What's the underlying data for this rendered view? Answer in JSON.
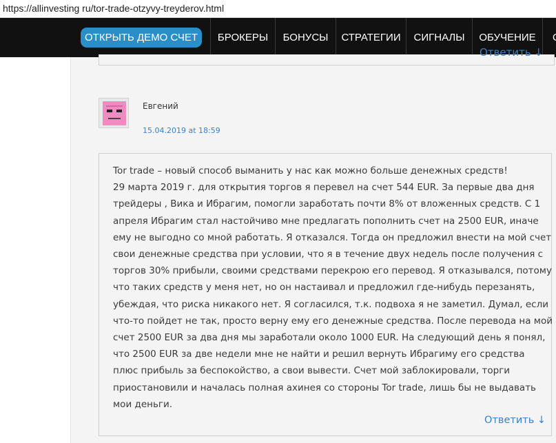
{
  "browser": {
    "url": "https://allinvesting ru/tor-trade-otzyvy-treyderov.html"
  },
  "nav": {
    "demo_label": "ОТКРЫТЬ ДЕМО СЧЕТ",
    "items": [
      "БРОКЕРЫ",
      "БОНУСЫ",
      "СТРАТЕГИИ",
      "СИГНАЛЫ",
      "ОБУЧЕНИЕ",
      "ОТЗ"
    ],
    "colors": {
      "background": "#111111",
      "demo_button": "#2a8fc7"
    }
  },
  "previous_comment": {
    "reply_label": "Ответить ↓"
  },
  "comment": {
    "avatar_icon": "pink-square-face-icon",
    "author": "Евгений",
    "date": "15.04.2019 at 18:59",
    "lines": [
      "Tor trade – новый способ выманить у нас как можно больше денежных средств!",
      "29 марта 2019 г. для открытия торгов я перевел на счет 544 EUR. За первые два дня",
      "трейдеры , Вика и Ибрагим, помогли заработать почти 8% от вложенных средств. С 1",
      "апреля Ибрагим стал настойчиво мне предлагать пополнить счет на 2500 EUR, иначе",
      "ему не выгодно со мной работать. Я отказался. Тогда он предложил внести на мой счет",
      "свои денежные средства при условии, что я в течение двух недель после получения с",
      "торгов 30% прибыли, своими средствами перекрою его перевод. Я отказывался, потому",
      "что таких средств у меня нет, но он настаивал и предложил где-нибудь перезанять,",
      "убеждая, что риска никакого нет. Я согласился, т.к. подвоха я не заметил. Думал, если",
      "что-то пойдет не так, просто верну ему его денежные средства. После перевода на мой",
      "счет 2500 EUR за два дня мы заработали около 1000 EUR. На следующий день я понял,",
      "что 2500 EUR за две недели мне не найти и решил вернуть Ибрагиму его средства",
      "плюс прибыль за беспокойство, а свои вывести. Счет мой заблокировали, торги",
      "приостановили и началась полная ахинея со стороны Tor trade, лишь бы не выдавать",
      "мои деньги."
    ],
    "reply_label": "Ответить ↓",
    "colors": {
      "link": "#3d7fc1",
      "text": "#3a3a3a"
    }
  }
}
